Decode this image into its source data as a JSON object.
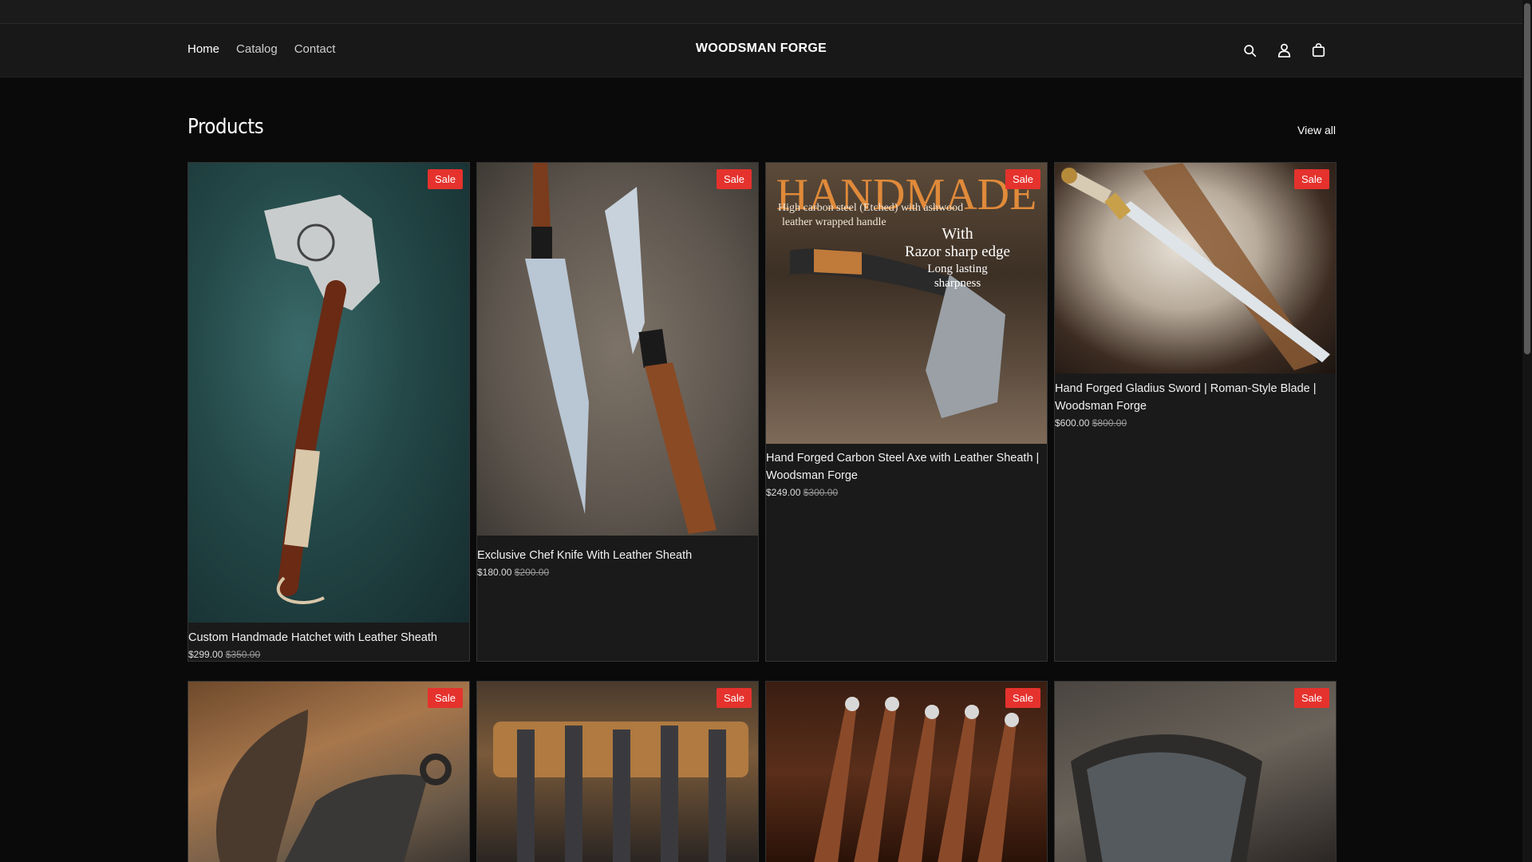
{
  "header": {
    "nav": [
      "Home",
      "Catalog",
      "Contact"
    ],
    "brand": "WOODSMAN FORGE",
    "icons": [
      "search-icon",
      "account-icon",
      "cart-icon"
    ]
  },
  "products_section": {
    "title": "Products",
    "view_all": "View all"
  },
  "products": [
    {
      "title": "Custom Handmade Hatchet with Leather Sheath",
      "price": "$299.00",
      "compare_price": "$350.00",
      "badge": "Sale"
    },
    {
      "title": "Exclusive Chef Knife With Leather Sheath",
      "price": "$180.00",
      "compare_price": "$200.00",
      "badge": "Sale"
    },
    {
      "title": "Hand Forged Carbon Steel Axe with Leather Sheath | Woodsman Forge",
      "price": "$249.00",
      "compare_price": "$300.00",
      "badge": "Sale",
      "image_text": {
        "headline": "HANDMADE",
        "line1": "High carbon steel (Etched) with ashwood",
        "line2": "leather wrapped handle",
        "line3": "With",
        "line4": "Razor sharp edge",
        "line5": "Long lasting",
        "line6": "sharpness"
      }
    },
    {
      "title": "Hand Forged Gladius Sword | Roman-Style Blade | Woodsman Forge",
      "price": "$600.00",
      "compare_price": "$800.00",
      "badge": "Sale"
    },
    {
      "badge": "Sale"
    },
    {
      "badge": "Sale"
    },
    {
      "badge": "Sale"
    },
    {
      "badge": "Sale"
    }
  ],
  "colors": {
    "sale_badge": "#e5322d",
    "background": "#0a0a0a",
    "card": "#1a1a1a"
  }
}
